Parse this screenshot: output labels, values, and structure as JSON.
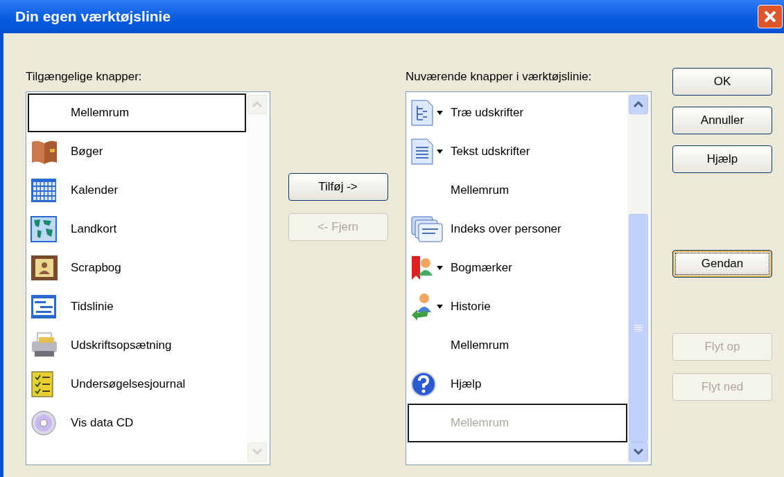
{
  "window": {
    "title": "Din egen værktøjslinie"
  },
  "available": {
    "label": "Tilgængelige knapper:",
    "items": [
      {
        "kind": "spacer",
        "label": "Mellemrum",
        "selected": true
      },
      {
        "kind": "button",
        "label": "Bøger",
        "selected": false
      },
      {
        "kind": "button",
        "label": "Kalender",
        "selected": false
      },
      {
        "kind": "button",
        "label": "Landkort",
        "selected": false
      },
      {
        "kind": "button",
        "label": "Scrapbog",
        "selected": false
      },
      {
        "kind": "button",
        "label": "Tidslinie",
        "selected": false
      },
      {
        "kind": "button",
        "label": "Udskriftsopsætning",
        "selected": false
      },
      {
        "kind": "button",
        "label": "Undersøgelsesjournal",
        "selected": false
      },
      {
        "kind": "button",
        "label": "Vis data CD",
        "selected": false
      }
    ]
  },
  "transfer_buttons": [
    {
      "label": "Tilføj ->",
      "disabled": false
    },
    {
      "label": "<- Fjern",
      "disabled": true
    }
  ],
  "current": {
    "label": "Nuværende knapper i værktøjslinie:",
    "items": [
      {
        "kind": "button",
        "label": "Træ udskrifter",
        "has_menu": true,
        "selected": false,
        "disabled": false
      },
      {
        "kind": "button",
        "label": "Tekst udskrifter",
        "has_menu": true,
        "selected": false,
        "disabled": false
      },
      {
        "kind": "spacer",
        "label": "Mellemrum",
        "has_menu": false,
        "selected": false,
        "disabled": false
      },
      {
        "kind": "button",
        "label": "Indeks over personer",
        "has_menu": false,
        "selected": false,
        "disabled": false
      },
      {
        "kind": "button",
        "label": "Bogmærker",
        "has_menu": true,
        "selected": false,
        "disabled": false
      },
      {
        "kind": "button",
        "label": "Historie",
        "has_menu": true,
        "selected": false,
        "disabled": false
      },
      {
        "kind": "spacer",
        "label": "Mellemrum",
        "has_menu": false,
        "selected": false,
        "disabled": false
      },
      {
        "kind": "button",
        "label": "Hjælp",
        "has_menu": false,
        "selected": false,
        "disabled": false
      },
      {
        "kind": "spacer",
        "label": "Mellemrum",
        "has_menu": false,
        "selected": true,
        "disabled": true
      }
    ]
  },
  "side_buttons": [
    {
      "label": "OK",
      "disabled": false,
      "focused": false
    },
    {
      "label": "Annuller",
      "disabled": false,
      "focused": false
    },
    {
      "label": "Hjælp",
      "disabled": false,
      "focused": false
    },
    {
      "label": "Gendan",
      "disabled": false,
      "focused": true
    },
    {
      "label": "Flyt op",
      "disabled": true,
      "focused": false
    },
    {
      "label": "Flyt ned",
      "disabled": true,
      "focused": false
    }
  ]
}
